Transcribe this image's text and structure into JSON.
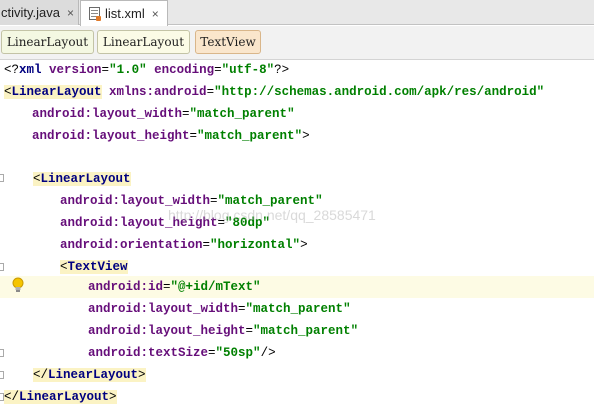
{
  "tabs": [
    {
      "label": "ctivity.java",
      "close": "×"
    },
    {
      "label": "list.xml",
      "close": "×"
    }
  ],
  "breadcrumbs": [
    "LinearLayout",
    "LinearLayout",
    "TextView"
  ],
  "code": {
    "l1": {
      "open": "<?",
      "tag": "xml",
      "a1": " version",
      "eq1": "=",
      "v1": "\"1.0\"",
      "a2": " encoding",
      "eq2": "=",
      "v2": "\"utf-8\"",
      "close": "?>"
    },
    "l2": {
      "open": "<",
      "tag": "LinearLayout",
      "ns": " xmlns:android",
      "eq": "=",
      "val": "\"http://schemas.android.com/apk/res/android\""
    },
    "l3": {
      "attr": "android:layout_width",
      "eq": "=",
      "val": "\"match_parent\""
    },
    "l4": {
      "attr": "android:layout_height",
      "eq": "=",
      "val": "\"match_parent\"",
      "close": ">"
    },
    "l6": {
      "open": "<",
      "tag": "LinearLayout"
    },
    "l7": {
      "attr": "android:layout_width",
      "eq": "=",
      "val": "\"match_parent\""
    },
    "l8": {
      "attr": "android:layout_height",
      "eq": "=",
      "val": "\"80dp\""
    },
    "l9": {
      "attr": "android:orientation",
      "eq": "=",
      "val": "\"horizontal\"",
      "close": ">"
    },
    "l10": {
      "open": "<",
      "tag": "TextView"
    },
    "l11": {
      "attr": "android:id",
      "eq": "=",
      "val": "\"@+id/mText\""
    },
    "l12": {
      "attr": "android:layout_width",
      "eq": "=",
      "val": "\"match_parent\""
    },
    "l13": {
      "attr": "android:layout_height",
      "eq": "=",
      "val": "\"match_parent\""
    },
    "l14": {
      "attr": "android:textSize",
      "eq": "=",
      "val": "\"50sp\"",
      "close": "/>"
    },
    "l15": {
      "open": "</",
      "tag": "LinearLayout",
      "close": ">"
    },
    "l16": {
      "open": "</",
      "tag": "LinearLayout",
      "close": ">"
    }
  },
  "watermark": "http://blog.csdn.net/qq_28585471",
  "colors": {
    "tag": "#000080",
    "attr": "#660e7a",
    "value": "#008000",
    "highlight_line": "#fdfbe4"
  },
  "icons": [
    "file-xml-icon",
    "lightbulb-icon",
    "fold-icon"
  ]
}
